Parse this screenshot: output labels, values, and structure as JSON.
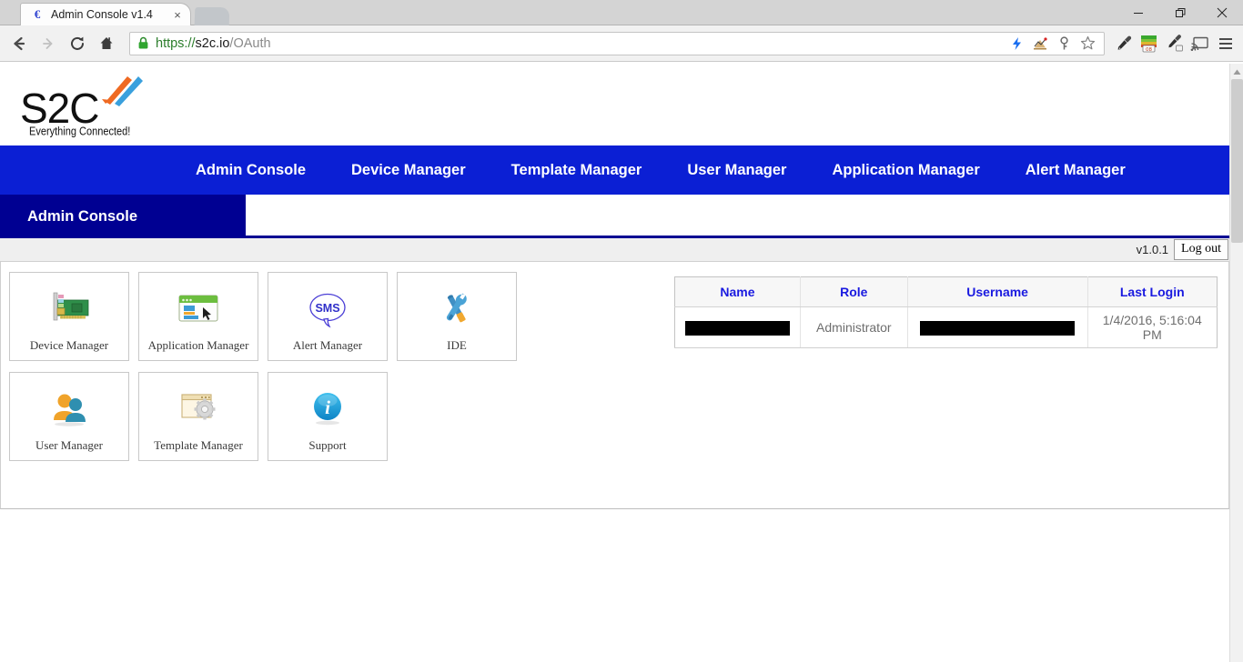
{
  "browser": {
    "tab": {
      "title": "Admin Console v1.4",
      "favicon": "s2c-favicon",
      "close": "×"
    },
    "new_tab_label": "",
    "window_controls": {
      "minimize": "—",
      "maximize": "❐",
      "close": "✕"
    },
    "nav": {
      "back": "←",
      "forward": "→",
      "reload": "⟳",
      "home": "⌂"
    },
    "omnibox": {
      "scheme": "https://",
      "host": "s2c.io",
      "path": "/OAuth",
      "full_url": "https://s2c.io/OAuth",
      "secure_label": "lock-icon"
    },
    "omnibox_icons": [
      "lightning-bolt-icon",
      "analytics-chart-icon",
      "key-icon",
      "bookmark-star-icon"
    ],
    "extension_icons": [
      "eyedropper-icon",
      "color-palette-icon",
      "color-picker-icon",
      "cast-icon",
      "menu-hamburger-icon"
    ]
  },
  "site": {
    "logo": {
      "text": "S2C",
      "tagline": "Everything Connected!"
    },
    "mainnav": [
      {
        "label": "Admin Console"
      },
      {
        "label": "Device Manager"
      },
      {
        "label": "Template Manager"
      },
      {
        "label": "User Manager"
      },
      {
        "label": "Application Manager"
      },
      {
        "label": "Alert Manager"
      }
    ],
    "section_tab": "Admin Console",
    "utilbar": {
      "version": "v1.0.1",
      "logout": "Log out"
    },
    "colors": {
      "nav_blue": "#0b1fd4",
      "tab_navy": "#000092",
      "header_link_blue": "#1a1ae0"
    }
  },
  "tiles": [
    [
      {
        "label": "Device Manager",
        "icon": "pci-card-icon"
      },
      {
        "label": "Application Manager",
        "icon": "browser-window-icon"
      },
      {
        "label": "Alert Manager",
        "icon": "sms-bubble-icon",
        "icon_text": "SMS"
      },
      {
        "label": "IDE",
        "icon": "wrench-screwdriver-icon"
      }
    ],
    [
      {
        "label": "User Manager",
        "icon": "users-icon"
      },
      {
        "label": "Template Manager",
        "icon": "window-gear-icon"
      },
      {
        "label": "Support",
        "icon": "info-circle-icon",
        "icon_text": "i"
      }
    ]
  ],
  "user_table": {
    "columns": [
      "Name",
      "Role",
      "Username",
      "Last Login"
    ],
    "rows": [
      {
        "name": "",
        "name_redacted": true,
        "role": "Administrator",
        "username": "",
        "username_redacted": true,
        "last_login": "1/4/2016, 5:16:04 PM"
      }
    ]
  }
}
